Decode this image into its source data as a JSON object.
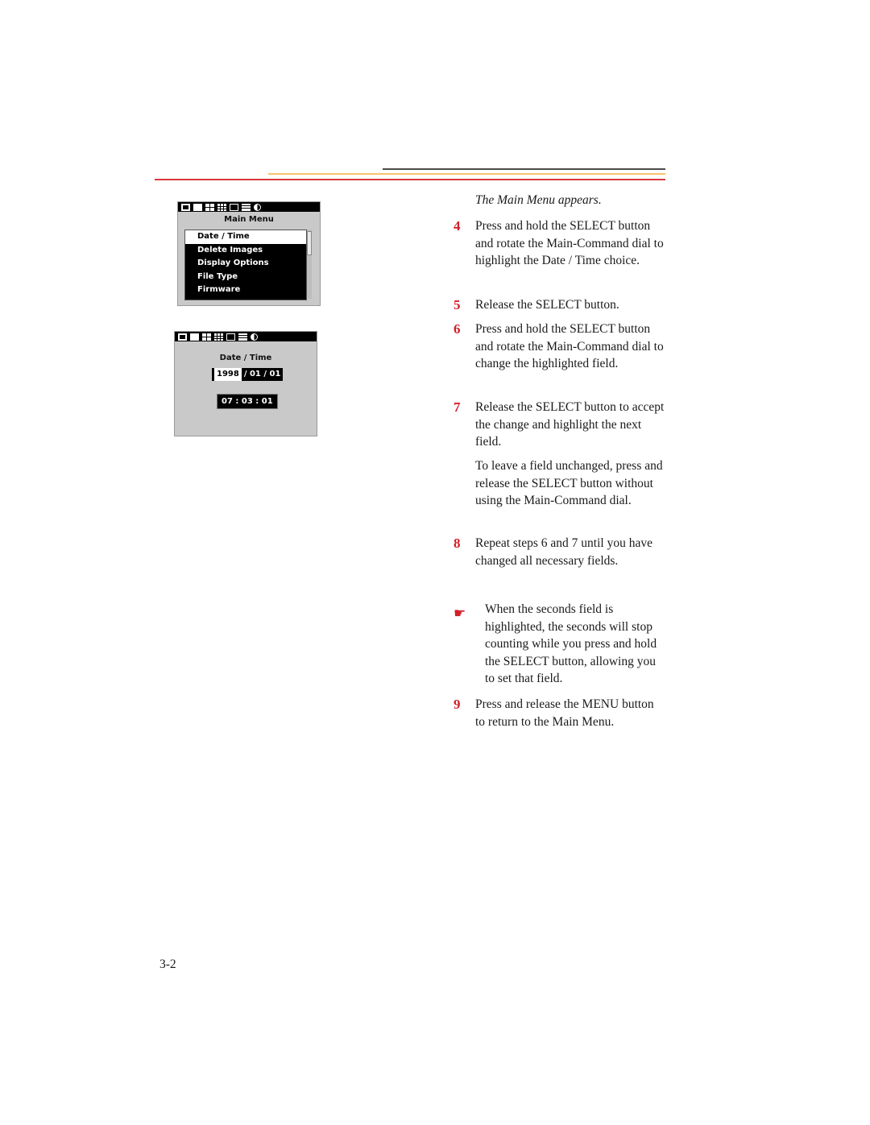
{
  "header_rules": {
    "colors": {
      "dark": "#4a4a4a",
      "orange": "#f7c26a",
      "red": "#d9363e"
    }
  },
  "lcd_main_menu": {
    "icon_bar": [
      "memory-card-icon",
      "single-frame-icon",
      "grid-4-icon",
      "grid-9-icon",
      "monitor-icon",
      "list-icon",
      "contrast-icon"
    ],
    "title": "Main Menu",
    "items": [
      {
        "label": "Date / Time",
        "selected": true
      },
      {
        "label": "Delete Images",
        "selected": false
      },
      {
        "label": "Display Options",
        "selected": false
      },
      {
        "label": "File Type",
        "selected": false
      },
      {
        "label": "Firmware",
        "selected": false
      }
    ]
  },
  "lcd_date_time": {
    "icon_bar": [
      "memory-card-icon",
      "single-frame-icon",
      "grid-4-icon",
      "grid-9-icon",
      "monitor-icon",
      "list-icon",
      "contrast-icon"
    ],
    "title": "Date / Time",
    "date_year": "1998",
    "date_rest": "/ 01 / 01",
    "time": "07 : 03 : 01"
  },
  "content": {
    "caption": "The Main Menu appears.",
    "steps": [
      {
        "number": "4",
        "text": "Press and hold the SELECT button and rotate the Main-Command dial to highlight the Date / Time choice."
      },
      {
        "number": "5",
        "text": "Release the SELECT button."
      },
      {
        "number": "6",
        "text": "Press and hold the SELECT button and rotate the Main-Command dial to change the highlighted field."
      },
      {
        "number": "7",
        "text": "Release the SELECT button to accept the change and highlight the next field."
      },
      {
        "number": "8",
        "text": "Repeat steps 6 and 7 until you have changed all necessary fields."
      },
      {
        "number": "9",
        "text": "Press and release the MENU button to return to the Main Menu."
      }
    ],
    "step7_note": "To leave a field unchanged, press and release the SELECT button without using the Main-Command dial.",
    "tip_icon": "☛",
    "tip_text": "When the seconds field is highlighted, the seconds will stop counting while you press and hold the SELECT button, allowing you to set that field."
  },
  "page_number": "3-2",
  "accent_color": "#d0202a"
}
